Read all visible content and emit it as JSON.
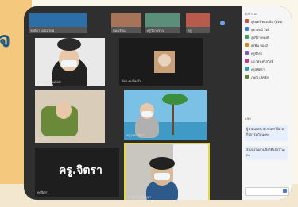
{
  "background": {
    "left_color": "#f4c97d",
    "bottom_color": "#f3e8cf"
  },
  "top_strip": {
    "tiles": [
      {
        "caption": "ชวลิตา ผลไม้ไหม้"
      },
      {
        "caption": "ห้องเรียน"
      },
      {
        "caption": "ครูวิลาวรรณ"
      },
      {
        "caption": "ครู"
      }
    ]
  },
  "grid": {
    "tiles": [
      {
        "caption": "yardung suksit"
      },
      {
        "caption": "ห้อง คนไทยใจ"
      },
      {
        "caption": "ครูสุพัตรา"
      },
      {
        "caption": "ครูวรรณนิภา"
      },
      {
        "caption": "ครูจิตรา"
      },
      {
        "caption": "นางสาว สุกัญญา"
      }
    ],
    "name_card": "ครู.จิตรา"
  },
  "sidebar": {
    "title": "ผู้เข้าร่วม",
    "participants": [
      "สุรินทร์ ทองแย้ม (ผู้จัด)",
      "สุดารัตน์ ใจดี",
      "สุปรียา ทองดี",
      "อรพิน ทองมี",
      "ครูจิตรา",
      "นภาพร ศรีสวัสดิ์",
      "ครูสุพัตรา",
      "ภุษณี เลิศชัย"
    ],
    "chat_title": "แชท",
    "messages": [
      "ผู้ร่วมแนะนำตัวกันจะได้เริ่มกิจกรรมกันนะคะ",
      "ส่งผลงานตามลิงก์ที่แจ้งไว้นะคะ"
    ],
    "input_placeholder": "ส่งข้อความ"
  }
}
